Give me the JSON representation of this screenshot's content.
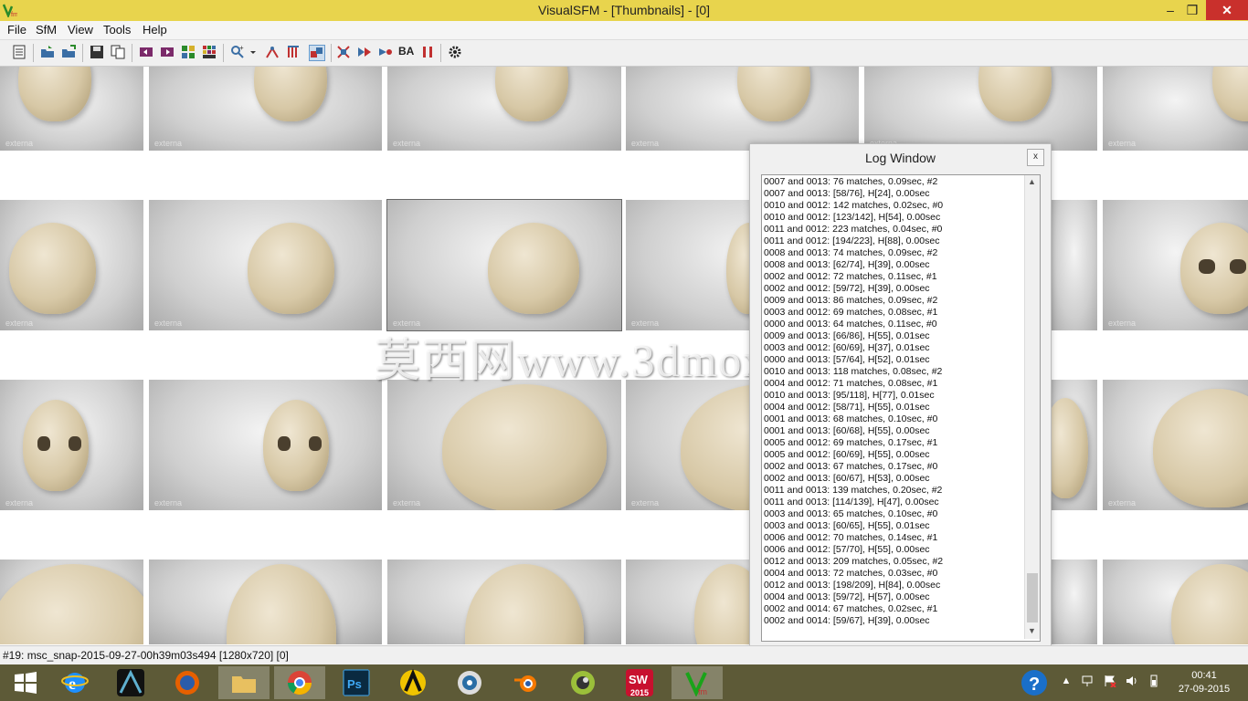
{
  "window": {
    "title": "VisualSFM - [Thumbnails] - [0]",
    "min": "–",
    "max": "❒",
    "close": "✕"
  },
  "menu": [
    "File",
    "SfM",
    "View",
    "Tools",
    "Help"
  ],
  "toolbar": {
    "ba_label": "BA"
  },
  "thumbnails": {
    "watermark": "externa"
  },
  "overlay_watermark": "莫西网www.3dmox.com",
  "log": {
    "title": "Log Window",
    "close": "x",
    "lines": [
      "0007 and 0013: 76 matches, 0.09sec, #2",
      "0007 and 0013: [58/76], H[24], 0.00sec",
      "0010 and 0012: 142 matches, 0.02sec, #0",
      "0010 and 0012: [123/142], H[54], 0.00sec",
      "0011 and 0012: 223 matches, 0.04sec, #0",
      "0011 and 0012: [194/223], H[88], 0.00sec",
      "0008 and 0013: 74 matches, 0.09sec, #2",
      "0008 and 0013: [62/74], H[39], 0.00sec",
      "0002 and 0012: 72 matches, 0.11sec, #1",
      "0002 and 0012: [59/72], H[39], 0.00sec",
      "0009 and 0013: 86 matches, 0.09sec, #2",
      "0003 and 0012: 69 matches, 0.08sec, #1",
      "0000 and 0013: 64 matches, 0.11sec, #0",
      "0009 and 0013: [66/86], H[55], 0.01sec",
      "0003 and 0012: [60/69], H[37], 0.01sec",
      "0000 and 0013: [57/64], H[52], 0.01sec",
      "0010 and 0013: 118 matches, 0.08sec, #2",
      "0004 and 0012: 71 matches, 0.08sec, #1",
      "0010 and 0013: [95/118], H[77], 0.01sec",
      "0004 and 0012: [58/71], H[55], 0.01sec",
      "0001 and 0013: 68 matches, 0.10sec, #0",
      "0001 and 0013: [60/68], H[55], 0.00sec",
      "0005 and 0012: 69 matches, 0.17sec, #1",
      "0005 and 0012: [60/69], H[55], 0.00sec",
      "0002 and 0013: 67 matches, 0.17sec, #0",
      "0002 and 0013: [60/67], H[53], 0.00sec",
      "0011 and 0013: 139 matches, 0.20sec, #2",
      "0011 and 0013: [114/139], H[47], 0.00sec",
      "0003 and 0013: 65 matches, 0.10sec, #0",
      "0003 and 0013: [60/65], H[55], 0.01sec",
      "0006 and 0012: 70 matches, 0.14sec, #1",
      "0006 and 0012: [57/70], H[55], 0.00sec",
      "0012 and 0013: 209 matches, 0.05sec, #2",
      "0004 and 0013: 72 matches, 0.03sec, #0",
      "0012 and 0013: [198/209], H[84], 0.00sec",
      "0004 and 0013: [59/72], H[57], 0.00sec",
      "0002 and 0014: 67 matches, 0.02sec, #1",
      "0002 and 0014: [59/67], H[39], 0.00sec"
    ]
  },
  "status": "#19: msc_snap-2015-09-27-00h39m03s494 [1280x720] [0]",
  "taskbar": {
    "apps": [
      "windows-start",
      "internet-explorer",
      "3ds-max",
      "firefox",
      "file-explorer",
      "chrome",
      "photoshop",
      "autodesk",
      "aperture",
      "blender",
      "zbrush",
      "solidworks-2015",
      "visualsfm"
    ],
    "solidworks_label": "2015",
    "time": "00:41",
    "date": "27-09-2015"
  },
  "colors": {
    "titlebar": "#e8d44d",
    "taskbar": "#5d5a37",
    "close": "#c9302c"
  }
}
